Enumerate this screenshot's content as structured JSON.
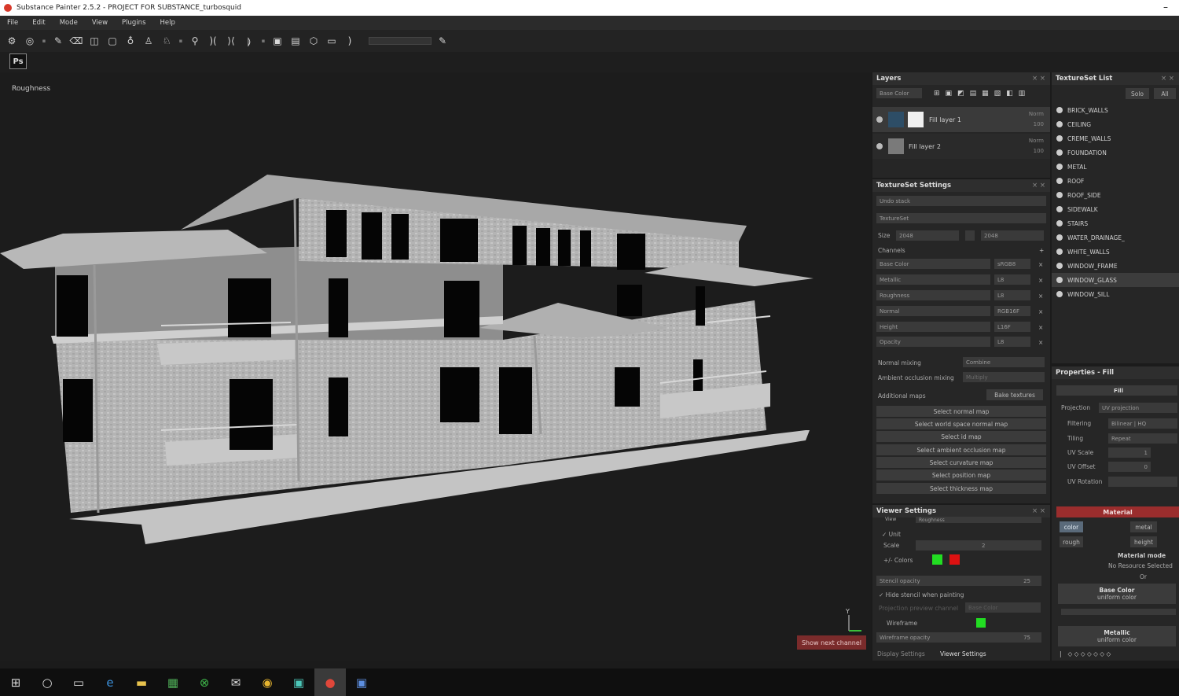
{
  "window": {
    "title": "Substance Painter 2.5.2 - PROJECT FOR SUBSTANCE_turbosquid"
  },
  "menu": [
    "File",
    "Edit",
    "Mode",
    "View",
    "Plugins",
    "Help"
  ],
  "toolbar2": {
    "ps_label": "Ps"
  },
  "viewport": {
    "channel_label": "Roughness",
    "show_next_channel": "Show next channel",
    "axis_y": "Y"
  },
  "layers": {
    "title": "Layers",
    "channel_select": "Base Color",
    "items": [
      {
        "name": "Fill layer 1",
        "blend": "Norm",
        "opacity": "100"
      },
      {
        "name": "Fill layer 2",
        "blend": "Norm",
        "opacity": "100"
      }
    ]
  },
  "textureset_settings": {
    "title": "TextureSet Settings",
    "undo_stack": "Undo stack",
    "textureset": "TextureSet",
    "size_label": "Size",
    "size_value": "2048",
    "size_value2": "2048",
    "channels_label": "Channels",
    "channels": [
      {
        "name": "Base Color",
        "format": "sRGB8"
      },
      {
        "name": "Metallic",
        "format": "L8"
      },
      {
        "name": "Roughness",
        "format": "L8"
      },
      {
        "name": "Normal",
        "format": "RGB16F"
      },
      {
        "name": "Height",
        "format": "L16F"
      },
      {
        "name": "Opacity",
        "format": "L8"
      }
    ],
    "normal_mixing_label": "Normal mixing",
    "normal_mixing_value": "Combine",
    "ao_mixing_label": "Ambient occlusion mixing",
    "ao_mixing_value": "Multiply",
    "additional_maps_label": "Additional maps",
    "bake_textures": "Bake textures",
    "map_buttons": [
      "Select normal map",
      "Select world space normal map",
      "Select id map",
      "Select ambient occlusion map",
      "Select curvature map",
      "Select position map",
      "Select thickness map"
    ]
  },
  "viewer_settings": {
    "title": "Viewer Settings",
    "view_label": "View",
    "view_value": "Roughness",
    "unit_label": "Unit",
    "scale_label": "Scale",
    "scale_value": "2",
    "colors_label": "+/- Colors",
    "stencil_opacity_label": "Stencil opacity",
    "stencil_opacity_value": "25",
    "hide_stencil_label": "Hide stencil when painting",
    "projection_channel_label": "Projection preview channel",
    "projection_channel_value": "Base Color",
    "wireframe_label": "Wireframe",
    "wireframe_opacity_label": "Wireframe opacity",
    "wireframe_opacity_value": "75",
    "tabs": [
      "Display Settings",
      "Viewer Settings"
    ],
    "color_positive": "#22dd22",
    "color_negative": "#dd1111",
    "wireframe_color": "#22dd22"
  },
  "textureset_list": {
    "title": "TextureSet List",
    "solo": "Solo",
    "all": "All",
    "items": [
      "BRICK_WALLS",
      "CEILING",
      "CREME_WALLS",
      "FOUNDATION",
      "METAL",
      "ROOF",
      "ROOF_SIDE",
      "SIDEWALK",
      "STAIRS",
      "WATER_DRAINAGE_",
      "WHITE_WALLS",
      "WINDOW_FRAME",
      "WINDOW_GLASS",
      "WINDOW_SILL"
    ]
  },
  "properties": {
    "title": "Properties - Fill",
    "fill_label": "Fill",
    "projection_label": "Projection",
    "projection_value": "UV projection",
    "filtering_label": "Filtering",
    "filtering_value": "Bilinear | HQ",
    "tiling_label": "Tiling",
    "tiling_value": "Repeat",
    "uv_scale_label": "UV Scale",
    "uv_scale_value": "1",
    "uv_offset_label": "UV Offset",
    "uv_offset_value": "0",
    "uv_rotation_label": "UV Rotation",
    "material_title": "Material",
    "material_buttons": [
      "color",
      "metal",
      "rough",
      "height"
    ],
    "material_mode": "Material mode",
    "no_resource": "No Resource Selected",
    "or": "Or",
    "base_color": "Base Color",
    "uniform_color_1": "uniform color",
    "metallic": "Metallic",
    "uniform_color_2": "uniform color"
  },
  "taskbar": {
    "icons": [
      "windows-start-icon",
      "search-circle-icon",
      "task-view-icon",
      "edge-browser-icon",
      "file-explorer-icon",
      "store-icon",
      "xbox-icon",
      "mail-icon",
      "chrome-icon",
      "substance-designer-icon",
      "substance-painter-icon",
      "photoshop-icon"
    ]
  }
}
